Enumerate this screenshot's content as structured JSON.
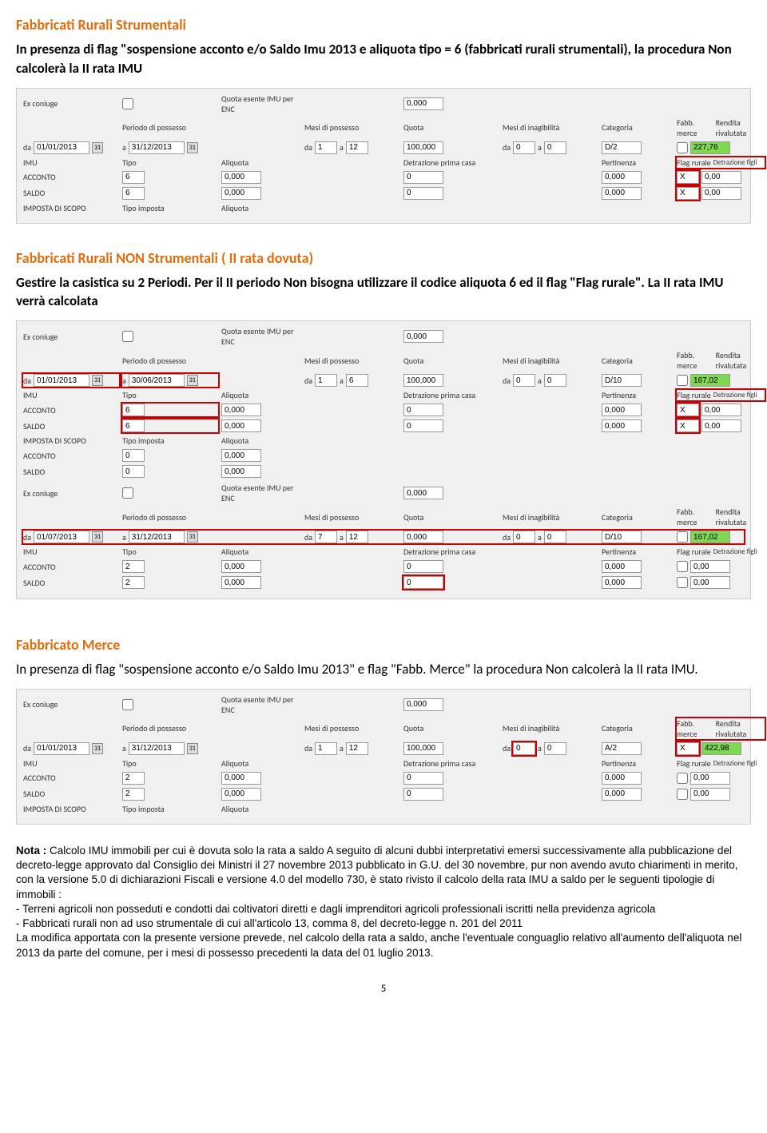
{
  "sec1": {
    "title": "Fabbricati Rurali Strumentali",
    "subtitle": "In presenza di flag \"sospensione acconto e/o Saldo Imu 2013 e aliquota tipo = 6 (fabbricati rurali strumentali), la procedura Non calcolerà la II rata IMU"
  },
  "labels": {
    "ex_coniuge": "Ex coniuge",
    "quota_esente": "Quota esente IMU per ENC",
    "periodo_possesso": "Periodo di possesso",
    "mesi_possesso": "Mesi di possesso",
    "quota": "Quota",
    "mesi_inagibilita": "Mesi di inagibilità",
    "categoria": "Categoria",
    "fabb_merce": "Fabb. merce",
    "rendita_rivalutata": "Rendita rivalutata",
    "da": "da",
    "a": "a",
    "imu": "IMU",
    "tipo": "Tipo",
    "aliquota": "Aliquota",
    "detrazione_prima_casa": "Detrazione prima casa",
    "pertinenza": "Pertinenza",
    "flag_rurale": "Flag rurale",
    "detrazione_figli": "Detrazione figli",
    "acconto": "ACCONTO",
    "saldo": "SALDO",
    "imposta_scopo": "IMPOSTA DI SCOPO",
    "tipo_imposta": "Tipo imposta"
  },
  "panel1": {
    "quota_esente": "0,000",
    "date_from": "01/01/2013",
    "date_to": "31/12/2013",
    "mese_da": "1",
    "mese_a": "12",
    "quota": "100,000",
    "inag_da": "0",
    "inag_a": "0",
    "categoria": "D/2",
    "rendita": "227,76",
    "acconto_tipo": "6",
    "acconto_aliq": "0,000",
    "acconto_detr": "0",
    "acconto_pert": "0,000",
    "acconto_flag": "X",
    "acconto_figli": "0,00",
    "saldo_tipo": "6",
    "saldo_aliq": "0,000",
    "saldo_detr": "0",
    "saldo_pert": "0,000",
    "saldo_flag": "X",
    "saldo_figli": "0,00"
  },
  "sec2": {
    "title": "Fabbricati Rurali  NON  Strumentali  ( II rata dovuta)",
    "subtitle": "Gestire la casistica su 2 Periodi. Per il II periodo Non bisogna utilizzare il codice aliquota 6 ed il flag \"Flag rurale\". La II rata IMU verrà calcolata"
  },
  "panel2a": {
    "quota_esente": "0,000",
    "date_from": "01/01/2013",
    "date_to": "30/06/2013",
    "mese_da": "1",
    "mese_a": "6",
    "quota": "100,000",
    "inag_da": "0",
    "inag_a": "0",
    "categoria": "D/10",
    "rendita": "167,02",
    "acconto_tipo": "6",
    "acconto_aliq": "0,000",
    "acconto_detr": "0",
    "acconto_pert": "0,000",
    "acconto_flag": "X",
    "acconto_figli": "0,00",
    "saldo_tipo": "6",
    "saldo_aliq": "0,000",
    "saldo_detr": "0",
    "saldo_pert": "0,000",
    "saldo_flag": "X",
    "saldo_figli": "0,00",
    "scopo_acc_tipo": "0",
    "scopo_acc_aliq": "0,000",
    "scopo_sal_tipo": "0",
    "scopo_sal_aliq": "0,000"
  },
  "panel2b": {
    "quota_esente": "0,000",
    "date_from": "01/07/2013",
    "date_to": "31/12/2013",
    "mese_da": "7",
    "mese_a": "12",
    "quota": "0,000",
    "inag_da": "0",
    "inag_a": "0",
    "categoria": "D/10",
    "rendita": "167,02",
    "acconto_tipo": "2",
    "acconto_aliq": "0,000",
    "acconto_detr": "0",
    "acconto_pert": "0,000",
    "acconto_figli": "0,00",
    "saldo_tipo": "2",
    "saldo_aliq": "0,000",
    "saldo_detr": "0",
    "saldo_pert": "0,000",
    "saldo_figli": "0,00"
  },
  "sec3": {
    "title": "Fabbricato Merce",
    "subtitle": "In presenza di flag \"sospensione acconto e/o Saldo Imu 2013\" e flag \"Fabb. Merce\" la procedura Non calcolerà la II rata IMU."
  },
  "panel3": {
    "quota_esente": "0,000",
    "date_from": "01/01/2013",
    "date_to": "31/12/2013",
    "mese_da": "1",
    "mese_a": "12",
    "quota": "100,000",
    "inag_da": "0",
    "inag_a": "0",
    "categoria": "A/2",
    "fabb_merce": "X",
    "rendita": "422,98",
    "acconto_tipo": "2",
    "acconto_aliq": "0,000",
    "acconto_detr": "0",
    "acconto_pert": "0,000",
    "acconto_figli": "0,00",
    "saldo_tipo": "2",
    "saldo_aliq": "0,000",
    "saldo_detr": "0",
    "saldo_pert": "0,000",
    "saldo_figli": "0,00"
  },
  "note": {
    "prefix": "Nota :",
    "body": " Calcolo IMU immobili per cui è dovuta solo la rata a saldo A seguito di alcuni dubbi interpretativi emersi successivamente alla pubblicazione del decreto-legge approvato dal Consiglio dei Ministri il 27 novembre 2013 pubblicato in G.U. del 30 novembre, pur non avendo avuto chiarimenti in merito, con la versione 5.0 di dichiarazioni Fiscali e versione 4.0 del modello 730, è stato rivisto il calcolo della rata IMU a saldo per le seguenti tipologie di immobili :",
    "li1": "- Terreni agricoli non posseduti e condotti dai coltivatori diretti e dagli imprenditori agricoli professionali iscritti nella previdenza agricola",
    "li2": "- Fabbricati rurali non ad uso strumentale di cui all'articolo 13, comma 8, del decreto-legge n. 201 del 2011",
    "body2": "La modifica apportata con la presente versione prevede, nel calcolo della rata a saldo, anche l'eventuale conguaglio relativo all'aumento dell'aliquota nel 2013 da parte del comune, per i mesi di possesso precedenti la data del 01 luglio 2013."
  },
  "page": "5"
}
